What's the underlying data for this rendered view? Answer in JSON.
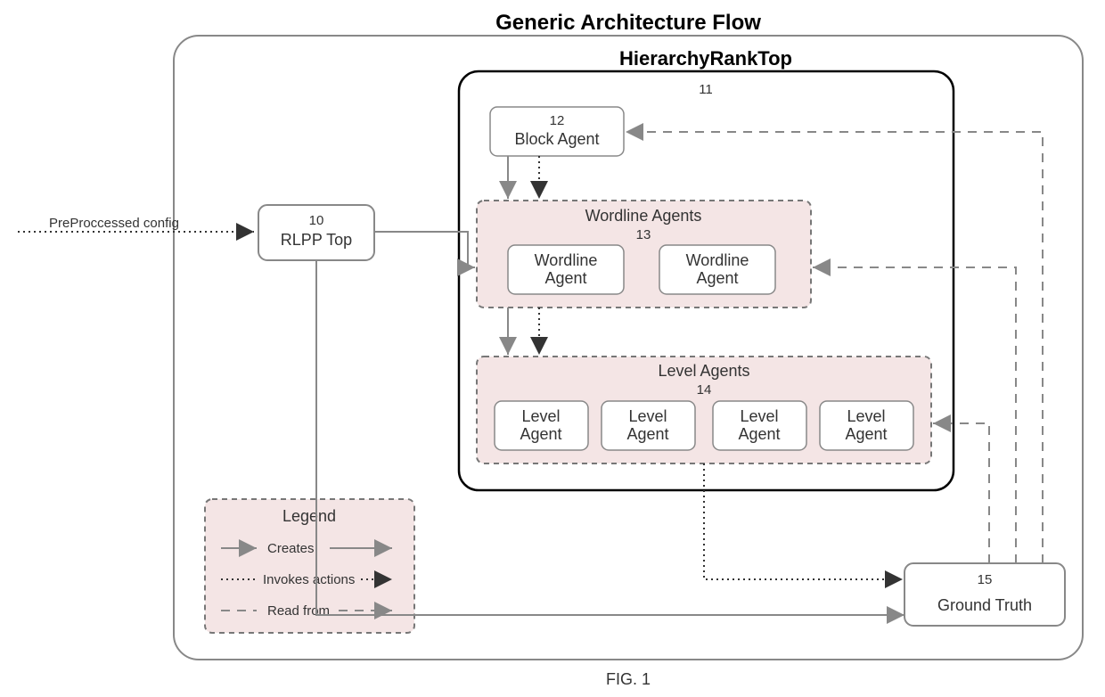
{
  "figure_caption": "FIG. 1",
  "outer": {
    "title": "Generic Architecture Flow"
  },
  "external_input": "PreProccessed config",
  "rlpp": {
    "num": "10",
    "label": "RLPP Top"
  },
  "hierarchy": {
    "title": "HierarchyRankTop",
    "num": "11",
    "block": {
      "num": "12",
      "label": "Block Agent"
    },
    "wordline": {
      "title": "Wordline Agents",
      "num": "13",
      "agent_label": "Wordline Agent"
    },
    "level": {
      "title": "Level Agents",
      "num": "14",
      "agent_label": "Level Agent"
    }
  },
  "ground_truth": {
    "num": "15",
    "label": "Ground Truth"
  },
  "legend": {
    "title": "Legend",
    "creates": "Creates",
    "invokes": "Invokes actions",
    "read": "Read from"
  }
}
